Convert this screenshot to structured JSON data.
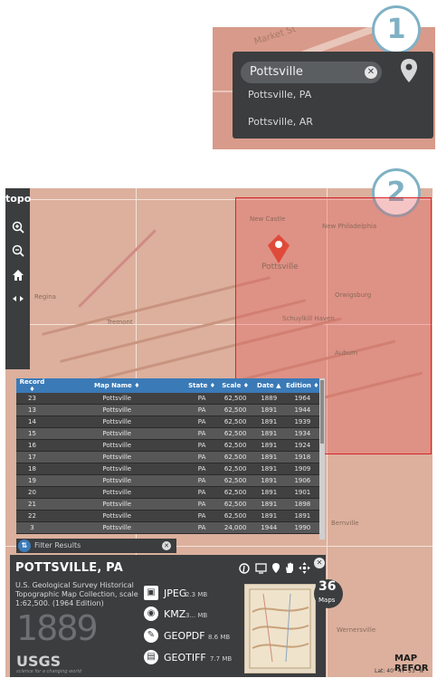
{
  "step1": {
    "badge": "1",
    "map_label": "Market St",
    "search_value": "Pottsville",
    "clear_glyph": "✕",
    "location_icon": "location-pin-icon",
    "suggestions": [
      "Pottsville, PA",
      "Pottsville, AR"
    ]
  },
  "step2": {
    "badge": "2",
    "toolbar": {
      "logo": "topo",
      "zoom_in": "zoom-in-icon",
      "zoom_out": "zoom-out-icon",
      "home": "home-icon",
      "collapse": "arrows-icon"
    },
    "map_labels": {
      "pottsville": "Pottsville",
      "new_castle": "New Castle",
      "new_philadelphia": "New Philadelphia",
      "orwigsburg": "Orwigsburg",
      "auburn": "Auburn",
      "schuylkill_haven": "Schuylkill Haven",
      "regina": "Regina",
      "tremont": "Tremont",
      "bernville": "Bernville",
      "wernersville": "Wernersville"
    },
    "table": {
      "columns": [
        "Record",
        "Map Name",
        "State",
        "Scale",
        "Date",
        "Edition"
      ],
      "rows": [
        [
          "23",
          "Pottsville",
          "PA",
          "62,500",
          "1889",
          "1964"
        ],
        [
          "13",
          "Pottsville",
          "PA",
          "62,500",
          "1891",
          "1944"
        ],
        [
          "14",
          "Pottsville",
          "PA",
          "62,500",
          "1891",
          "1939"
        ],
        [
          "15",
          "Pottsville",
          "PA",
          "62,500",
          "1891",
          "1934"
        ],
        [
          "16",
          "Pottsville",
          "PA",
          "62,500",
          "1891",
          "1924"
        ],
        [
          "17",
          "Pottsville",
          "PA",
          "62,500",
          "1891",
          "1918"
        ],
        [
          "18",
          "Pottsville",
          "PA",
          "62,500",
          "1891",
          "1909"
        ],
        [
          "19",
          "Pottsville",
          "PA",
          "62,500",
          "1891",
          "1906"
        ],
        [
          "20",
          "Pottsville",
          "PA",
          "62,500",
          "1891",
          "1901"
        ],
        [
          "21",
          "Pottsville",
          "PA",
          "62,500",
          "1891",
          "1898"
        ],
        [
          "22",
          "Pottsville",
          "PA",
          "62,500",
          "1891",
          "1891"
        ],
        [
          "3",
          "Pottsville",
          "PA",
          "24,000",
          "1944",
          "1990"
        ]
      ]
    },
    "filter": {
      "placeholder": "Filter Results"
    },
    "info": {
      "title": "POTTSVILLE, PA",
      "description": "U.S. Geological Survey Historical Topographic Map Collection, scale 1:62,500. (1964 Edition)",
      "year": "1889",
      "publisher": "USGS",
      "tagline": "science for a changing world",
      "downloads": [
        {
          "label": "JPEG",
          "size": "2.3 MB",
          "icon": "image-icon"
        },
        {
          "label": "KMZ",
          "size": "3... MB",
          "icon": "globe-icon"
        },
        {
          "label": "GEOPDF",
          "size": "8.6 MB",
          "icon": "pdf-icon"
        },
        {
          "label": "GEOTIFF",
          "size": "7.7 MB",
          "icon": "file-icon"
        }
      ],
      "count": "36",
      "count_label": "Maps"
    },
    "map_ref": "MAP REFOR",
    "coordinates": "Lat: 40° 47' 53\" N"
  }
}
